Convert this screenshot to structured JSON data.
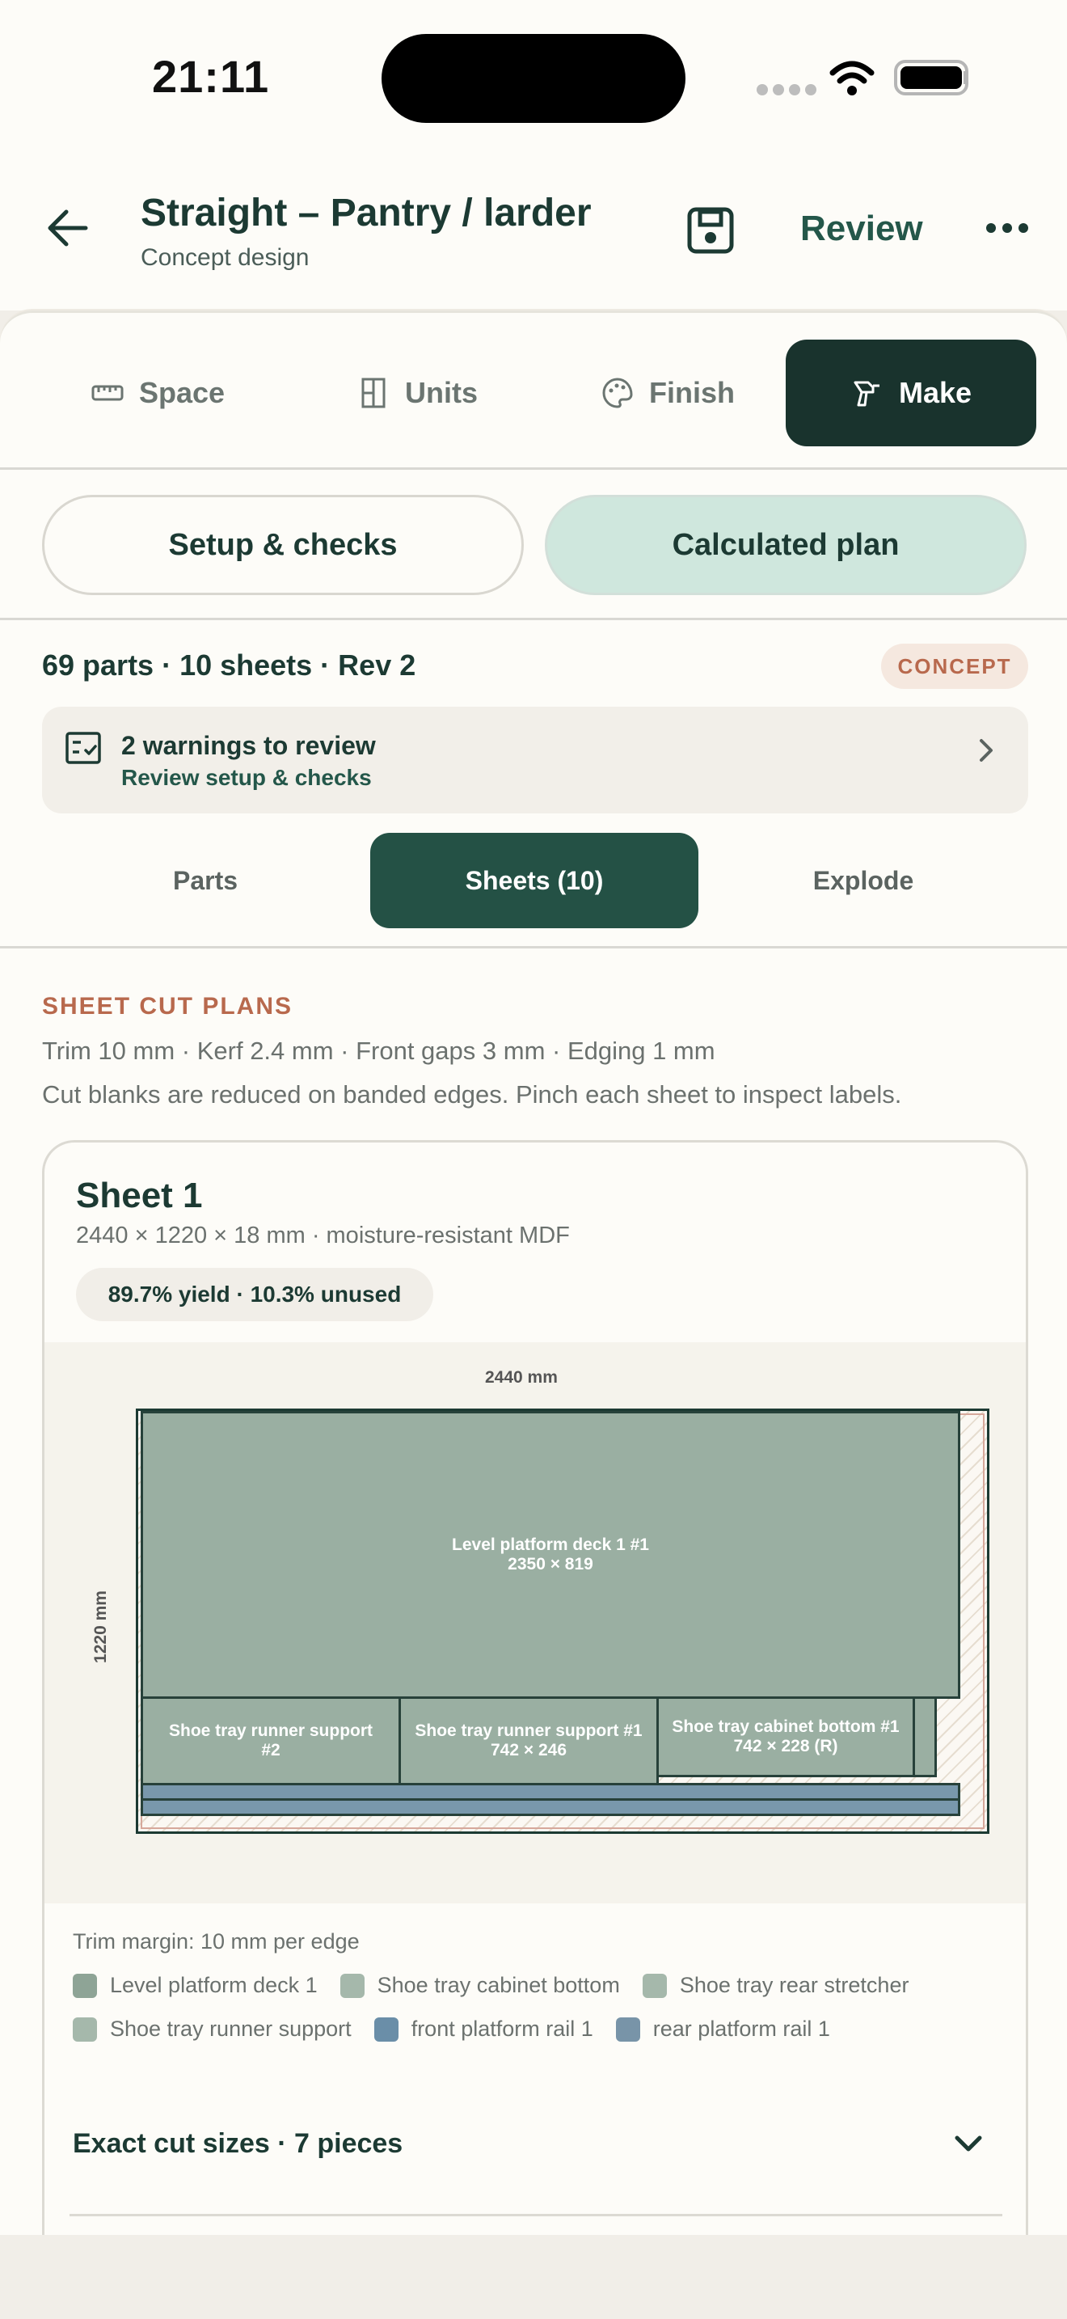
{
  "status": {
    "time": "21:11"
  },
  "header": {
    "title": "Straight – Pantry / larder",
    "subtitle": "Concept design",
    "review_label": "Review"
  },
  "tabs": [
    {
      "label": "Space",
      "icon": "ruler-icon"
    },
    {
      "label": "Units",
      "icon": "cabinet-icon"
    },
    {
      "label": "Finish",
      "icon": "palette-icon"
    },
    {
      "label": "Make",
      "icon": "drill-icon",
      "active": true
    }
  ],
  "segments": {
    "setup": "Setup & checks",
    "plan": "Calculated plan"
  },
  "summary": {
    "text": "69 parts  ·  10 sheets  ·  Rev 2",
    "badge": "CONCEPT"
  },
  "warnings": {
    "title": "2 warnings to review",
    "subtitle": "Review setup & checks"
  },
  "subtabs": {
    "parts": "Parts",
    "sheets": "Sheets (10)",
    "explode": "Explode"
  },
  "section": {
    "title": "SHEET CUT PLANS",
    "line1": "Trim 10 mm · Kerf 2.4 mm · Front gaps 3 mm · Edging 1 mm",
    "line2": "Cut blanks are reduced on banded edges. Pinch each sheet to inspect labels."
  },
  "sheet": {
    "title": "Sheet 1",
    "specs": "2440 × 1220 × 18 mm · moisture-resistant MDF",
    "yield": "89.7% yield · 10.3% unused",
    "width_label": "2440 mm",
    "height_label": "1220 mm",
    "parts": [
      {
        "name": "Level platform deck 1 #1",
        "size": "2350 × 819"
      },
      {
        "name": "Shoe tray runner support #2",
        "size": ""
      },
      {
        "name": "Shoe tray runner support #1",
        "size": "742 × 246"
      },
      {
        "name": "Shoe tray cabinet bottom #1",
        "size": "742 × 228 (R)"
      }
    ],
    "trim_note": "Trim margin: 10 mm per edge",
    "legend": [
      {
        "label": "Level platform deck 1",
        "color": "#8ea496"
      },
      {
        "label": "Shoe tray cabinet bottom",
        "color": "#a5b8ab"
      },
      {
        "label": "Shoe tray rear stretcher",
        "color": "#a5b8ab"
      },
      {
        "label": "Shoe tray runner support",
        "color": "#a5b8ab"
      },
      {
        "label": "front platform rail 1",
        "color": "#6a8ea8"
      },
      {
        "label": "rear platform rail 1",
        "color": "#7894a8"
      }
    ],
    "exact_label": "Exact cut sizes · 7 pieces"
  },
  "colors": {
    "accent": "#19332d",
    "brand": "#245145",
    "warm": "#b8694d"
  }
}
